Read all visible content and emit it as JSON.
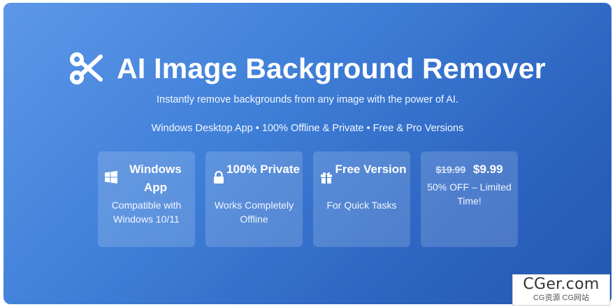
{
  "banner": {
    "title": "AI Image Background Remover",
    "logo_icon": "scissors-icon",
    "subtitle": "Instantly remove backgrounds from any image with the power of AI.",
    "features": "Windows Desktop App • 100% Offline & Private • Free & Pro Versions",
    "colors": {
      "gradient_start": "#5d98e8",
      "gradient_end": "#2457b2",
      "text": "#ffffff"
    }
  },
  "cards": [
    {
      "icon": "windows-icon",
      "title": "Windows App",
      "desc": "Compatible with Windows 10/11"
    },
    {
      "icon": "lock-icon",
      "title": "100% Private",
      "desc": "Works Completely Offline"
    },
    {
      "icon": "gift-icon",
      "title": "Free Version",
      "desc": "For Quick Tasks"
    },
    {
      "old_price": "$19.99",
      "new_price": "$9.99",
      "desc": "50% OFF – Limited Time!"
    }
  ],
  "watermark": {
    "main": "CGer.com",
    "sub": "CG资源 CG网站"
  }
}
